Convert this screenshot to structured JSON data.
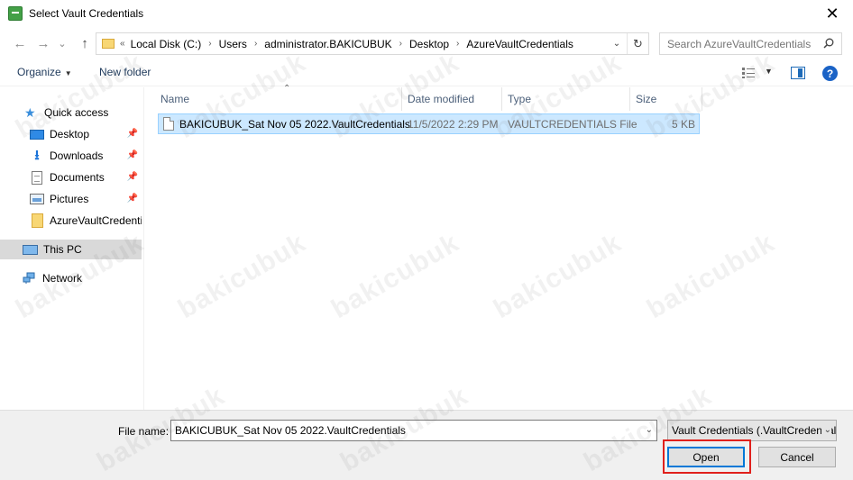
{
  "window": {
    "title": "Select Vault Credentials",
    "close_glyph": "✕"
  },
  "nav": {
    "back_glyph": "←",
    "forward_glyph": "→",
    "recent_glyph": "⌄",
    "up_glyph": "↑"
  },
  "address": {
    "overflow": "«",
    "crumbs": [
      "Local Disk (C:)",
      "Users",
      "administrator.BAKICUBUK",
      "Desktop",
      "AzureVaultCredentials"
    ],
    "separator": "›"
  },
  "search": {
    "placeholder": "Search AzureVaultCredentials"
  },
  "toolbar": {
    "organize": "Organize",
    "new_folder": "New folder",
    "help": "?"
  },
  "sidebar": {
    "quick_access": "Quick access",
    "items": [
      {
        "label": "Desktop",
        "icon": "desktop-icon"
      },
      {
        "label": "Downloads",
        "icon": "downloads-icon"
      },
      {
        "label": "Documents",
        "icon": "documents-icon"
      },
      {
        "label": "Pictures",
        "icon": "pictures-icon"
      },
      {
        "label": "AzureVaultCredentials",
        "icon": "folder-icon"
      }
    ],
    "this_pc": "This PC",
    "network": "Network"
  },
  "columns": {
    "name": "Name",
    "date": "Date modified",
    "type": "Type",
    "size": "Size"
  },
  "files": [
    {
      "name": "BAKICUBUK_Sat Nov 05 2022.VaultCredentials",
      "date": "11/5/2022 2:29 PM",
      "type": "VAULTCREDENTIALS File",
      "size": "5 KB"
    }
  ],
  "footer": {
    "file_name_label": "File name:",
    "file_name_value": "BAKICUBUK_Sat Nov 05 2022.VaultCredentials",
    "file_type": "Vault Credentials (.VaultCredentials)",
    "open": "Open",
    "cancel": "Cancel"
  },
  "watermark": "bakicubuk",
  "colors": {
    "selection": "#cce8ff",
    "highlight": "#e0201c",
    "accent": "#0078d7"
  }
}
